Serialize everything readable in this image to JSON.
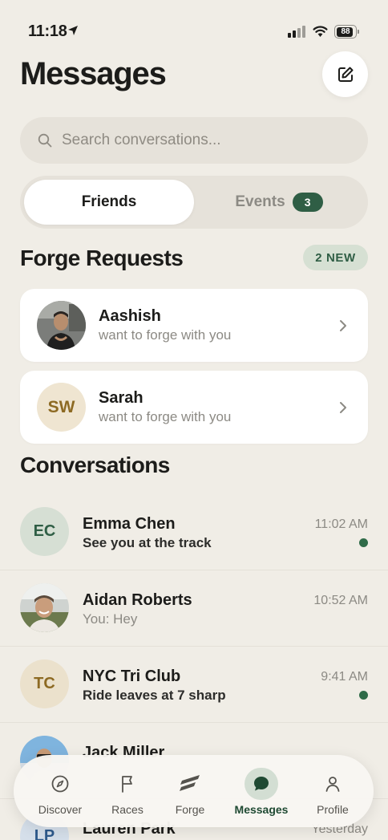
{
  "status_bar": {
    "time": "11:18",
    "battery": "88",
    "battery_level": 0.88
  },
  "header": {
    "title": "Messages"
  },
  "search": {
    "placeholder": "Search conversations..."
  },
  "segments": {
    "friends_label": "Friends",
    "events_label": "Events",
    "events_count": "3"
  },
  "forge_requests": {
    "title": "Forge Requests",
    "badge": "2 NEW",
    "items": [
      {
        "name": "Aashish",
        "subtitle": "want to forge with you",
        "initials": ""
      },
      {
        "name": "Sarah",
        "subtitle": "want to forge with you",
        "initials": "SW"
      }
    ]
  },
  "conversations": {
    "title": "Conversations",
    "items": [
      {
        "initials": "EC",
        "name": "Emma Chen",
        "message": "See you at the track",
        "time": "11:02 AM",
        "unread": true
      },
      {
        "initials": "",
        "name": "Aidan Roberts",
        "message": "You: Hey",
        "time": "10:52 AM",
        "unread": false
      },
      {
        "initials": "TC",
        "name": "NYC Tri Club",
        "message": "Ride leaves at 7 sharp",
        "time": "9:41 AM",
        "unread": true
      },
      {
        "initials": "",
        "name": "Jack Miller",
        "message": "",
        "time": "",
        "unread": false
      },
      {
        "initials": "LP",
        "name": "Lauren Park",
        "message": "",
        "time": "Yesterday",
        "unread": false
      }
    ]
  },
  "tab_bar": {
    "tabs": [
      {
        "label": "Discover",
        "icon": "compass-icon"
      },
      {
        "label": "Races",
        "icon": "flag-icon"
      },
      {
        "label": "Forge",
        "icon": "forge-logo-icon"
      },
      {
        "label": "Messages",
        "icon": "chat-bubble-icon",
        "active": true
      },
      {
        "label": "Profile",
        "icon": "person-icon"
      }
    ]
  },
  "colors": {
    "background": "#f0ede6",
    "accent_green": "#2f5e45",
    "unread_dot": "#2f6b48",
    "muted_text": "#8c8a84",
    "card": "#ffffff"
  }
}
